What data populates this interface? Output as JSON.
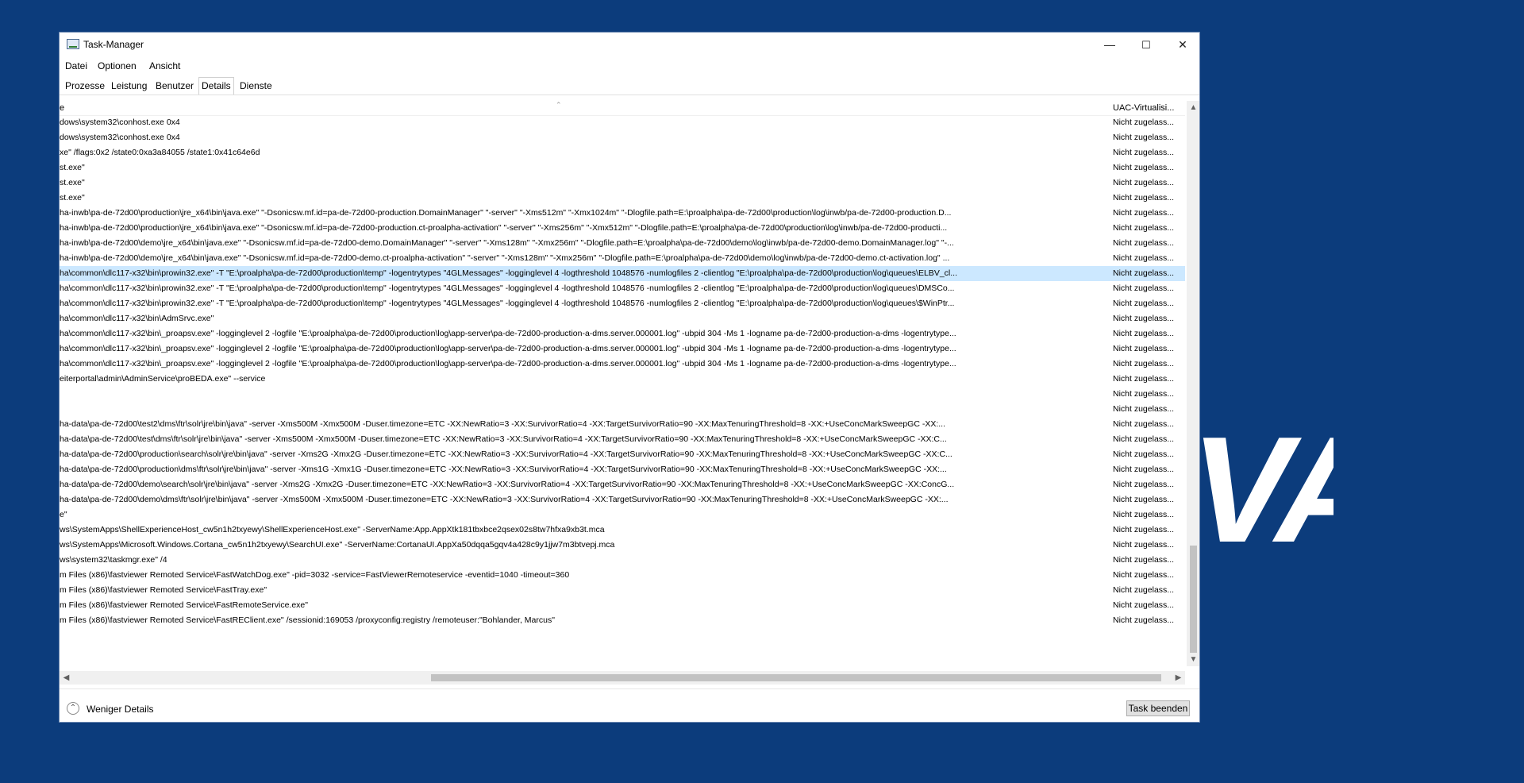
{
  "window": {
    "title": "Task-Manager",
    "minimize": "—",
    "maximize": "☐",
    "close": "✕"
  },
  "menu": [
    "Datei",
    "Optionen",
    "Ansicht"
  ],
  "tabs": [
    {
      "label": "Prozesse",
      "active": false
    },
    {
      "label": "Leistung",
      "active": false
    },
    {
      "label": "Benutzer",
      "active": false
    },
    {
      "label": "Details",
      "active": true
    },
    {
      "label": "Dienste",
      "active": false
    }
  ],
  "columns": {
    "command_line": "e",
    "uac": "UAC-Virtualisi..."
  },
  "rows": [
    {
      "cmd": "dows\\system32\\conhost.exe 0x4",
      "uac": "Nicht zugelass...",
      "selected": false
    },
    {
      "cmd": "dows\\system32\\conhost.exe 0x4",
      "uac": "Nicht zugelass...",
      "selected": false
    },
    {
      "cmd": "xe\" /flags:0x2 /state0:0xa3a84055 /state1:0x41c64e6d",
      "uac": "Nicht zugelass...",
      "selected": false
    },
    {
      "cmd": "st.exe\"",
      "uac": "Nicht zugelass...",
      "selected": false
    },
    {
      "cmd": "st.exe\"",
      "uac": "Nicht zugelass...",
      "selected": false
    },
    {
      "cmd": "st.exe\"",
      "uac": "Nicht zugelass...",
      "selected": false
    },
    {
      "cmd": "ha-inwb\\pa-de-72d00\\production\\jre_x64\\bin\\java.exe\" \"-Dsonicsw.mf.id=pa-de-72d00-production.DomainManager\" \"-server\" \"-Xms512m\" \"-Xmx1024m\" \"-Dlogfile.path=E:\\proalpha\\pa-de-72d00\\production\\log\\inwb/pa-de-72d00-production.D...",
      "uac": "Nicht zugelass...",
      "selected": false
    },
    {
      "cmd": "ha-inwb\\pa-de-72d00\\production\\jre_x64\\bin\\java.exe\" \"-Dsonicsw.mf.id=pa-de-72d00-production.ct-proalpha-activation\" \"-server\" \"-Xms256m\" \"-Xmx512m\" \"-Dlogfile.path=E:\\proalpha\\pa-de-72d00\\production\\log\\inwb/pa-de-72d00-producti...",
      "uac": "Nicht zugelass...",
      "selected": false
    },
    {
      "cmd": "ha-inwb\\pa-de-72d00\\demo\\jre_x64\\bin\\java.exe\" \"-Dsonicsw.mf.id=pa-de-72d00-demo.DomainManager\" \"-server\" \"-Xms128m\" \"-Xmx256m\" \"-Dlogfile.path=E:\\proalpha\\pa-de-72d00\\demo\\log\\inwb/pa-de-72d00-demo.DomainManager.log\" \"-...",
      "uac": "Nicht zugelass...",
      "selected": false
    },
    {
      "cmd": "ha-inwb\\pa-de-72d00\\demo\\jre_x64\\bin\\java.exe\" \"-Dsonicsw.mf.id=pa-de-72d00-demo.ct-proalpha-activation\" \"-server\" \"-Xms128m\" \"-Xmx256m\" \"-Dlogfile.path=E:\\proalpha\\pa-de-72d00\\demo\\log\\inwb/pa-de-72d00-demo.ct-activation.log\" ...",
      "uac": "Nicht zugelass...",
      "selected": false
    },
    {
      "cmd": "ha\\common\\dlc117-x32\\bin\\prowin32.exe\"  -T \"E:\\proalpha\\pa-de-72d00\\production\\temp\" -logentrytypes \"4GLMessages\" -logginglevel 4 -logthreshold 1048576 -numlogfiles 2 -clientlog \"E:\\proalpha\\pa-de-72d00\\production\\log\\queues\\ELBV_cl...",
      "uac": "Nicht zugelass...",
      "selected": true
    },
    {
      "cmd": "ha\\common\\dlc117-x32\\bin\\prowin32.exe\"  -T \"E:\\proalpha\\pa-de-72d00\\production\\temp\" -logentrytypes \"4GLMessages\" -logginglevel 4 -logthreshold 1048576 -numlogfiles 2 -clientlog \"E:\\proalpha\\pa-de-72d00\\production\\log\\queues\\DMSCo...",
      "uac": "Nicht zugelass...",
      "selected": false
    },
    {
      "cmd": "ha\\common\\dlc117-x32\\bin\\prowin32.exe\"  -T \"E:\\proalpha\\pa-de-72d00\\production\\temp\" -logentrytypes \"4GLMessages\" -logginglevel 4 -logthreshold 1048576 -numlogfiles 2 -clientlog \"E:\\proalpha\\pa-de-72d00\\production\\log\\queues\\$WinPtr...",
      "uac": "Nicht zugelass...",
      "selected": false
    },
    {
      "cmd": "ha\\common\\dlc117-x32\\bin\\AdmSrvc.exe\"",
      "uac": "Nicht zugelass...",
      "selected": false
    },
    {
      "cmd": "ha\\common\\dlc117-x32\\bin\\_proapsv.exe\"  -logginglevel 2 -logfile \"E:\\proalpha\\pa-de-72d00\\production\\log\\app-server\\pa-de-72d00-production-a-dms.server.000001.log\" -ubpid 304 -Ms 1 -logname pa-de-72d00-production-a-dms -logentrytype...",
      "uac": "Nicht zugelass...",
      "selected": false
    },
    {
      "cmd": "ha\\common\\dlc117-x32\\bin\\_proapsv.exe\"  -logginglevel 2 -logfile \"E:\\proalpha\\pa-de-72d00\\production\\log\\app-server\\pa-de-72d00-production-a-dms.server.000001.log\" -ubpid 304 -Ms 1 -logname pa-de-72d00-production-a-dms -logentrytype...",
      "uac": "Nicht zugelass...",
      "selected": false
    },
    {
      "cmd": "ha\\common\\dlc117-x32\\bin\\_proapsv.exe\"  -logginglevel 2 -logfile \"E:\\proalpha\\pa-de-72d00\\production\\log\\app-server\\pa-de-72d00-production-a-dms.server.000001.log\" -ubpid 304 -Ms 1 -logname pa-de-72d00-production-a-dms -logentrytype...",
      "uac": "Nicht zugelass...",
      "selected": false
    },
    {
      "cmd": "eiterportal\\admin\\AdminService\\proBEDA.exe\" --service",
      "uac": "Nicht zugelass...",
      "selected": false
    },
    {
      "cmd": "",
      "uac": "Nicht zugelass...",
      "selected": false
    },
    {
      "cmd": "",
      "uac": "Nicht zugelass...",
      "selected": false
    },
    {
      "cmd": "ha-data\\pa-de-72d00\\test2\\dms\\ftr\\solr\\jre\\bin\\java\"  -server -Xms500M -Xmx500M -Duser.timezone=ETC -XX:NewRatio=3   -XX:SurvivorRatio=4   -XX:TargetSurvivorRatio=90   -XX:MaxTenuringThreshold=8   -XX:+UseConcMarkSweepGC   -XX:...",
      "uac": "Nicht zugelass...",
      "selected": false
    },
    {
      "cmd": "ha-data\\pa-de-72d00\\test\\dms\\ftr\\solr\\jre\\bin\\java\"  -server -Xms500M -Xmx500M -Duser.timezone=ETC -XX:NewRatio=3   -XX:SurvivorRatio=4   -XX:TargetSurvivorRatio=90   -XX:MaxTenuringThreshold=8   -XX:+UseConcMarkSweepGC   -XX:C...",
      "uac": "Nicht zugelass...",
      "selected": false
    },
    {
      "cmd": "ha-data\\pa-de-72d00\\production\\search\\solr\\jre\\bin\\java\"  -server -Xms2G -Xmx2G -Duser.timezone=ETC -XX:NewRatio=3   -XX:SurvivorRatio=4   -XX:TargetSurvivorRatio=90   -XX:MaxTenuringThreshold=8   -XX:+UseConcMarkSweepGC   -XX:C...",
      "uac": "Nicht zugelass...",
      "selected": false
    },
    {
      "cmd": "ha-data\\pa-de-72d00\\production\\dms\\ftr\\solr\\jre\\bin\\java\"  -server -Xms1G -Xmx1G -Duser.timezone=ETC -XX:NewRatio=3   -XX:SurvivorRatio=4   -XX:TargetSurvivorRatio=90   -XX:MaxTenuringThreshold=8   -XX:+UseConcMarkSweepGC   -XX:...",
      "uac": "Nicht zugelass...",
      "selected": false
    },
    {
      "cmd": "ha-data\\pa-de-72d00\\demo\\search\\solr\\jre\\bin\\java\"  -server -Xms2G -Xmx2G -Duser.timezone=ETC -XX:NewRatio=3   -XX:SurvivorRatio=4   -XX:TargetSurvivorRatio=90   -XX:MaxTenuringThreshold=8   -XX:+UseConcMarkSweepGC   -XX:ConcG...",
      "uac": "Nicht zugelass...",
      "selected": false
    },
    {
      "cmd": "ha-data\\pa-de-72d00\\demo\\dms\\ftr\\solr\\jre\\bin\\java\"  -server -Xms500M -Xmx500M -Duser.timezone=ETC -XX:NewRatio=3   -XX:SurvivorRatio=4   -XX:TargetSurvivorRatio=90   -XX:MaxTenuringThreshold=8   -XX:+UseConcMarkSweepGC   -XX:...",
      "uac": "Nicht zugelass...",
      "selected": false
    },
    {
      "cmd": "e\"",
      "uac": "Nicht zugelass...",
      "selected": false
    },
    {
      "cmd": "ws\\SystemApps\\ShellExperienceHost_cw5n1h2txyewy\\ShellExperienceHost.exe\" -ServerName:App.AppXtk181tbxbce2qsex02s8tw7hfxa9xb3t.mca",
      "uac": "Nicht zugelass...",
      "selected": false
    },
    {
      "cmd": "ws\\SystemApps\\Microsoft.Windows.Cortana_cw5n1h2txyewy\\SearchUI.exe\" -ServerName:CortanaUI.AppXa50dqqa5gqv4a428c9y1jjw7m3btvepj.mca",
      "uac": "Nicht zugelass...",
      "selected": false
    },
    {
      "cmd": "ws\\system32\\taskmgr.exe\" /4",
      "uac": "Nicht zugelass...",
      "selected": false
    },
    {
      "cmd": "m Files (x86)\\fastviewer Remoted Service\\FastWatchDog.exe\" -pid=3032 -service=FastViewerRemoteservice -eventid=1040 -timeout=360",
      "uac": "Nicht zugelass...",
      "selected": false
    },
    {
      "cmd": "m Files (x86)\\fastviewer Remoted Service\\FastTray.exe\"",
      "uac": "Nicht zugelass...",
      "selected": false
    },
    {
      "cmd": "m Files (x86)\\fastviewer Remoted Service\\FastRemoteService.exe\"",
      "uac": "Nicht zugelass...",
      "selected": false
    },
    {
      "cmd": "m Files (x86)\\fastviewer Remoted Service\\FastREClient.exe\"  /sessionid:169053 /proxyconfig:registry /remoteuser:\"Bohlander, Marcus\"",
      "uac": "Nicht zugelass...",
      "selected": false
    }
  ],
  "footer": {
    "fewer_details": "Weniger Details",
    "end_task": "Task beenden"
  },
  "background": {
    "brand_text": "VA",
    "color": "#0c3c7c"
  }
}
